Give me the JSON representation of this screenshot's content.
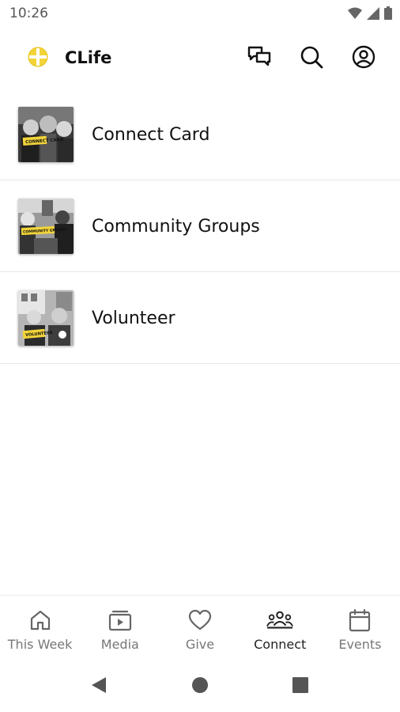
{
  "status_bar": {
    "time": "10:26"
  },
  "app_bar": {
    "title": "CLife"
  },
  "list": {
    "items": [
      {
        "label": "Connect Card",
        "badge": "CONNECT CARD"
      },
      {
        "label": "Community Groups",
        "badge": "COMMUNITY GROUPS"
      },
      {
        "label": "Volunteer",
        "badge": "VOLUNTEER"
      }
    ]
  },
  "bottom_nav": {
    "items": [
      {
        "label": "This Week",
        "icon": "home-icon"
      },
      {
        "label": "Media",
        "icon": "media-icon"
      },
      {
        "label": "Give",
        "icon": "heart-icon"
      },
      {
        "label": "Connect",
        "icon": "people-icon",
        "active": true
      },
      {
        "label": "Events",
        "icon": "calendar-icon"
      }
    ]
  },
  "colors": {
    "accent_yellow": "#f2d43a",
    "text": "#111111",
    "inactive": "#777777"
  }
}
